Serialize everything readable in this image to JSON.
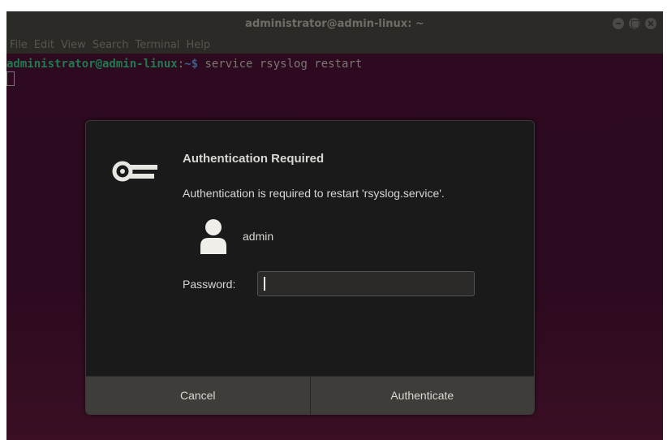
{
  "window": {
    "title": "administrator@admin-linux: ~"
  },
  "menubar": {
    "items": [
      "File",
      "Edit",
      "View",
      "Search",
      "Terminal",
      "Help"
    ]
  },
  "terminal": {
    "prompt_user": "administrator@admin-linux",
    "prompt_colon": ":",
    "prompt_path": "~$",
    "command": " service rsyslog restart"
  },
  "dialog": {
    "icon": "key-icon",
    "title": "Authentication Required",
    "message": "Authentication is required to restart 'rsyslog.service'.",
    "user_icon": "user-icon",
    "user_name": "admin",
    "password_label": "Password:",
    "password_value": "",
    "cancel_label": "Cancel",
    "authenticate_label": "Authenticate"
  },
  "colors": {
    "terminal_bg": "#2c0920",
    "prompt_user": "#1e7a4f",
    "prompt_path": "#3a5f8a",
    "dialog_bg": "#1a1a1a",
    "button_bg": "#3e3d3a"
  }
}
